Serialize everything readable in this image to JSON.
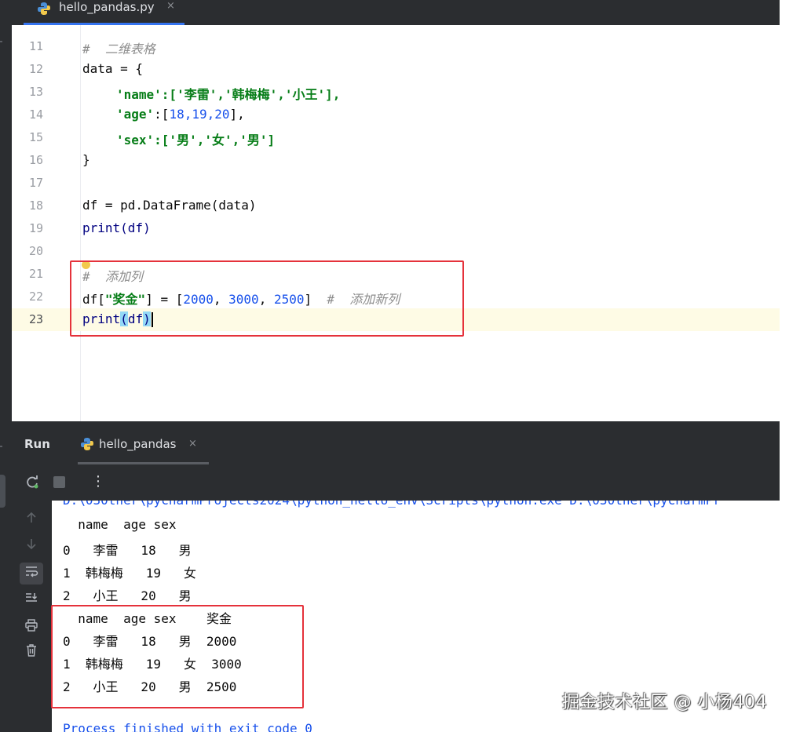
{
  "editor_tab": {
    "filename": "hello_pandas.py",
    "close_glyph": "×"
  },
  "editor_lines": [
    {
      "num": "11",
      "text": "#  二维表格"
    },
    {
      "num": "12",
      "text": "data = {"
    },
    {
      "num": "13",
      "text": "'name':['李雷','韩梅梅','小王'],"
    },
    {
      "num": "14",
      "text": "'age':[18,19,20],"
    },
    {
      "num": "15",
      "text": "'sex':['男','女','男']"
    },
    {
      "num": "16",
      "text": "}"
    },
    {
      "num": "17",
      "text": ""
    },
    {
      "num": "18",
      "text": "df = pd.DataFrame(data)"
    },
    {
      "num": "19",
      "text": "print(df)"
    },
    {
      "num": "20",
      "text": ""
    },
    {
      "num": "21",
      "text": "#  添加列"
    },
    {
      "num": "22",
      "text": "df[\"奖金\"] = [2000, 3000, 2500]  #  添加新列"
    },
    {
      "num": "23",
      "text": "print(df)"
    }
  ],
  "run_panel": {
    "title": "Run",
    "tab_label": "hello_pandas",
    "close_glyph": "×",
    "more_glyph": "⋮"
  },
  "console": {
    "path_line": "D:\\030ther\\pycharmProjects2024\\python_hello_env\\Scripts\\python.exe D:\\030ther\\pycharmPr",
    "table1": [
      "  name  age sex",
      "0   李雷   18   男",
      "1  韩梅梅   19   女",
      "2   小王   20   男"
    ],
    "table2": [
      "  name  age sex    奖金",
      "0   李雷   18   男  2000",
      "1  韩梅梅   19   女  3000",
      "2   小王   20   男  2500"
    ],
    "exit_line": "Process finished with exit code 0"
  },
  "watermark": "掘金技术社区 @ 小杨404",
  "colors": {
    "dark_chrome": "#2b2d30",
    "highlight_box": "#e5323b",
    "current_line": "#fefbe5",
    "string_green": "#067d17",
    "number_blue": "#1750eb"
  }
}
